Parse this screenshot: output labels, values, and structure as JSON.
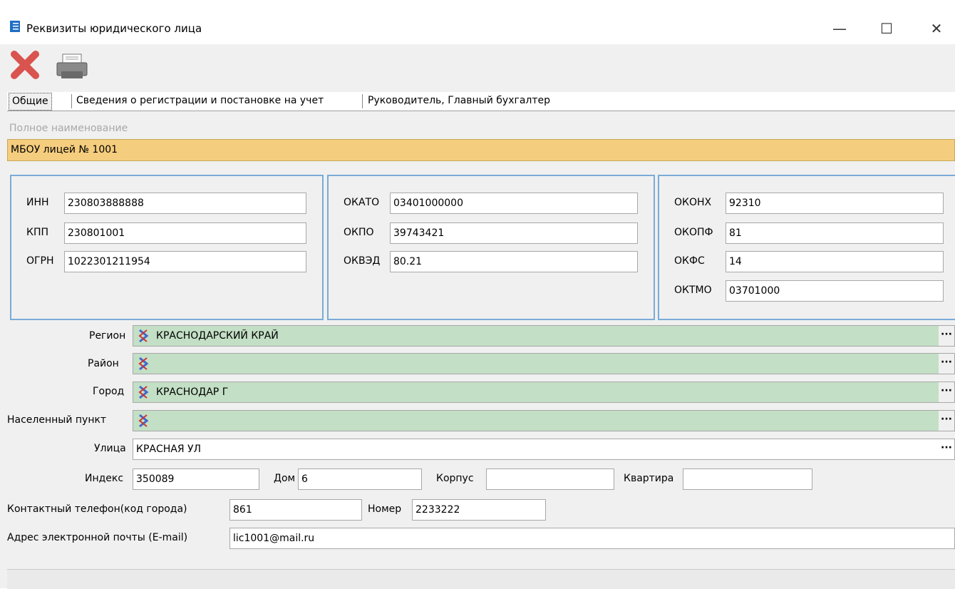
{
  "window": {
    "title": "Реквизиты юридического лица",
    "minimize_glyph": "—",
    "maximize_glyph": "☐",
    "close_glyph": "✕"
  },
  "toolbar": {
    "delete_icon": "red-x-icon",
    "print_icon": "printer-icon"
  },
  "tabs": [
    {
      "label": "Общие",
      "active": true
    },
    {
      "label": "Сведения о регистрации и постановке на учет",
      "active": false
    },
    {
      "label": "Руководитель, Главный бухгалтер",
      "active": false
    }
  ],
  "full_name": {
    "label": "Полное наименование",
    "value": "МБОУ лицей № 1001"
  },
  "codes_group1": {
    "inn_label": "ИНН",
    "inn_value": "230803888888",
    "kpp_label": "КПП",
    "kpp_value": "230801001",
    "ogrn_label": "ОГРН",
    "ogrn_value": "1022301211954"
  },
  "codes_group2": {
    "okato_label": "ОКАТО",
    "okato_value": "03401000000",
    "okpo_label": "ОКПО",
    "okpo_value": "39743421",
    "okved_label": "ОКВЭД",
    "okved_value": "80.21"
  },
  "codes_group3": {
    "okonh_label": "ОКОНХ",
    "okonh_value": "92310",
    "okopf_label": "ОКОПФ",
    "okopf_value": "81",
    "okfs_label": "ОКФС",
    "okfs_value": "14",
    "oktmo_label": "ОКТМО",
    "oktmo_value": "03701000"
  },
  "address": {
    "region_label": "Регион",
    "region_value": "КРАСНОДАРСКИЙ КРАЙ",
    "district_label": "Район",
    "district_value": "",
    "city_label": "Город",
    "city_value": "КРАСНОДАР Г",
    "locality_label": "Населенный пункт",
    "locality_value": "",
    "street_label": "Улица",
    "street_value": "КРАСНАЯ УЛ",
    "ellipsis": "···",
    "index_label": "Индекс",
    "index_value": "350089",
    "house_label": "Дом",
    "house_value": "6",
    "building_label": "Корпус",
    "building_value": "",
    "apartment_label": "Квартира",
    "apartment_value": ""
  },
  "contacts": {
    "phone_label": "Контактный телефон(код города)",
    "phone_code": "861",
    "number_label": "Номер",
    "number_value": "2233222",
    "email_label": "Адрес электронной почты (E-mail)",
    "email_value": "lic1001@mail.ru"
  },
  "colors": {
    "name_field_bg": "#f5cd7e",
    "address_field_bg": "#c3dfc5",
    "group_border": "#7aabd8"
  }
}
